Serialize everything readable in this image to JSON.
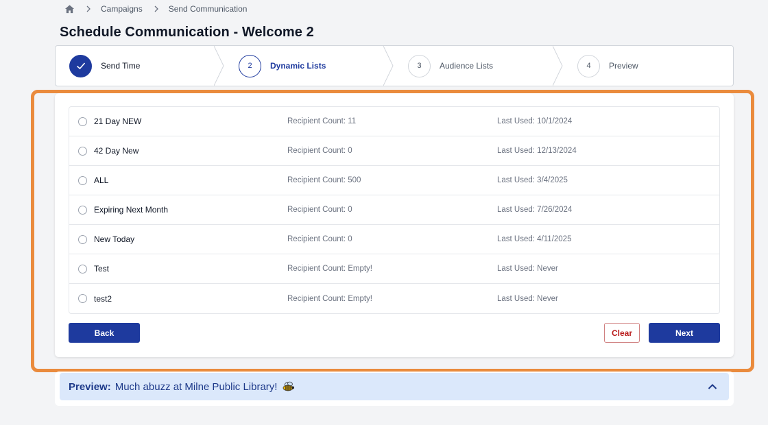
{
  "breadcrumb": {
    "home_icon": "home-icon",
    "items": [
      "Campaigns",
      "Send Communication"
    ]
  },
  "page": {
    "title": "Schedule Communication - Welcome 2"
  },
  "stepper": {
    "steps": [
      {
        "number": "",
        "label": "Send Time",
        "state": "done"
      },
      {
        "number": "2",
        "label": "Dynamic Lists",
        "state": "active"
      },
      {
        "number": "3",
        "label": "Audience Lists",
        "state": "upcoming"
      },
      {
        "number": "4",
        "label": "Preview",
        "state": "upcoming"
      }
    ]
  },
  "lists": [
    {
      "name": "21 Day NEW",
      "count": "Recipient Count: 11",
      "last_used": "Last Used: 10/1/2024",
      "selected": false
    },
    {
      "name": "42 Day New",
      "count": "Recipient Count: 0",
      "last_used": "Last Used: 12/13/2024",
      "selected": false
    },
    {
      "name": "ALL",
      "count": "Recipient Count: 500",
      "last_used": "Last Used: 3/4/2025",
      "selected": false
    },
    {
      "name": "Expiring Next Month",
      "count": "Recipient Count: 0",
      "last_used": "Last Used: 7/26/2024",
      "selected": false
    },
    {
      "name": "New Today",
      "count": "Recipient Count: 0",
      "last_used": "Last Used: 4/11/2025",
      "selected": false
    },
    {
      "name": "Test",
      "count": "Recipient Count: Empty!",
      "last_used": "Last Used: Never",
      "selected": false
    },
    {
      "name": "test2",
      "count": "Recipient Count: Empty!",
      "last_used": "Last Used: Never",
      "selected": false
    }
  ],
  "buttons": {
    "back": "Back",
    "clear": "Clear",
    "next": "Next"
  },
  "preview": {
    "label": "Preview:",
    "text": "Much abuzz at Milne Public Library!",
    "icon": "bee-icon",
    "toggle_icon": "chevron-up-icon"
  },
  "colors": {
    "primary": "#1e3a9e",
    "highlight": "#ea8b3d",
    "preview_bg": "#dbe8fb",
    "clear": "#b91c1c"
  }
}
